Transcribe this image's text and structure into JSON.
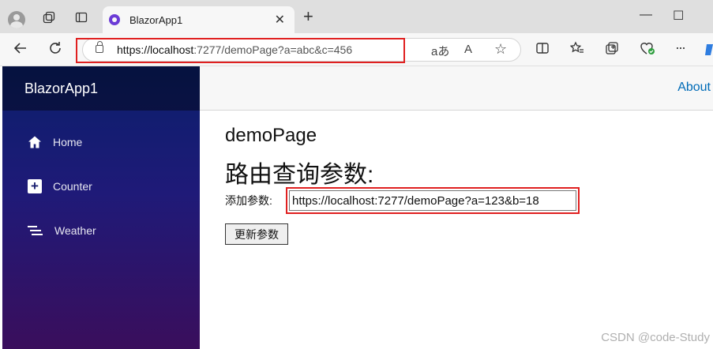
{
  "browser": {
    "tab_title": "BlazorApp1",
    "tab_close": "✕",
    "new_tab": "+",
    "window": {
      "minimize": "—",
      "maximize": "☐"
    },
    "url_host": "https://localhost",
    "url_rest": ":7277/demoPage?a=abc&c=456",
    "url_icons": {
      "read_aloud_label": "aあ",
      "font_label": "A",
      "favorite": "☆"
    },
    "toolbar_icons": [
      "split-screen-icon",
      "favorites-icon",
      "collections-icon",
      "browser-essentials-icon",
      "more-icon"
    ],
    "more_label": "···"
  },
  "sidebar": {
    "brand": "BlazorApp1",
    "items": [
      {
        "label": "Home",
        "icon": "home-icon"
      },
      {
        "label": "Counter",
        "icon": "plus-icon"
      },
      {
        "label": "Weather",
        "icon": "list-icon"
      }
    ]
  },
  "topbar": {
    "about": "About"
  },
  "main": {
    "title": "demoPage",
    "subtitle": "路由查询参数:",
    "param_label": "添加参数:",
    "param_value": "https://localhost:7277/demoPage?a=123&b=18",
    "update_button": "更新参数"
  },
  "watermark": "CSDN @code-Study",
  "colors": {
    "accent_link": "#006bb7",
    "highlight": "#e02020",
    "sidebar_top": "#0a1f6b",
    "sidebar_bottom": "#3a0e5c"
  }
}
